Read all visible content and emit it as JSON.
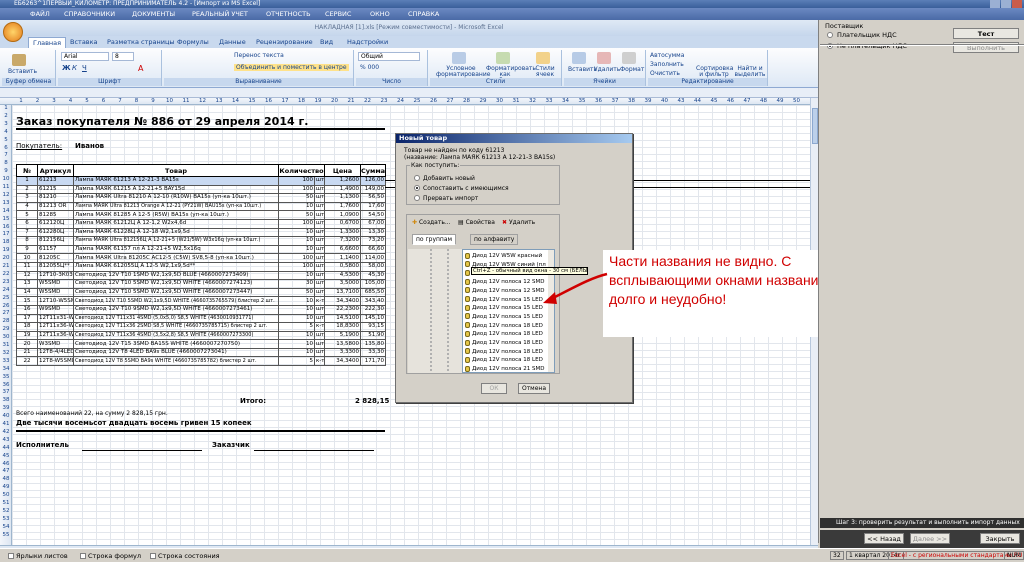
{
  "window": {
    "title": "ЕБ6263^1ПЕРВЫЙ_КИЛОМЕТР: ПРЕДПРИНИМАТЕЛЬ 4.2 - [Импорт из MS Excel]",
    "menu": [
      "ФАЙЛ",
      "СПРАВОЧНИКИ",
      "ДОКУМЕНТЫ",
      "РЕАЛЬНЫЙ УЧЕТ",
      "ОТЧЕТНОСТЬ",
      "СЕРВИС",
      "ОКНО",
      "СПРАВКА"
    ]
  },
  "excel": {
    "title": "НАКЛАДНАЯ [1].xls [Режим совместимости] - Microsoft Excel",
    "ribbon_tabs": [
      "Главная",
      "Вставка",
      "Разметка страницы",
      "Формулы",
      "Данные",
      "Рецензирование",
      "Вид",
      "Надстройки"
    ],
    "ribbon": {
      "paste": "Вставить",
      "font_name": "Arial",
      "font_size": "8",
      "wrap": "Перенос текста",
      "merge": "Объединить и поместить в центре",
      "number_format": "Общий",
      "cond_format": "Условное форматирование",
      "format_table": "Форматировать как таблицу",
      "cell_styles": "Стили ячеек",
      "insert": "Вставить",
      "delete": "Удалить",
      "format": "Формат",
      "autosum": "Автосумма",
      "fill": "Заполнить",
      "clear": "Очистить",
      "sort": "Сортировка и фильтр",
      "find": "Найти и выделить",
      "groups": [
        "Буфер обмена",
        "Шрифт",
        "Выравнивание",
        "Число",
        "Стили",
        "Ячейки",
        "Редактирование"
      ]
    },
    "columns": [
      "1",
      "2",
      "3",
      "4",
      "5",
      "6",
      "7",
      "8",
      "9",
      "10",
      "11",
      "12",
      "13",
      "14",
      "15",
      "16",
      "17",
      "18",
      "19",
      "20",
      "21",
      "22",
      "23",
      "24",
      "25",
      "26",
      "27",
      "28",
      "29",
      "30",
      "31",
      "32",
      "33",
      "34",
      "35",
      "36",
      "37",
      "38",
      "39",
      "40",
      "43",
      "44",
      "45",
      "46",
      "47",
      "48",
      "49",
      "50"
    ],
    "rows": [
      "1",
      "2",
      "3",
      "4",
      "5",
      "6",
      "7",
      "8",
      "9",
      "10",
      "11",
      "12",
      "13",
      "14",
      "15",
      "16",
      "17",
      "18",
      "19",
      "20",
      "21",
      "22",
      "23",
      "24",
      "25",
      "26",
      "27",
      "28",
      "29",
      "30",
      "31",
      "32",
      "33",
      "34",
      "35",
      "36",
      "37",
      "38",
      "39",
      "40",
      "41",
      "42",
      "43",
      "44",
      "45",
      "46",
      "47",
      "48",
      "49",
      "50",
      "51",
      "52",
      "53",
      "54",
      "55"
    ],
    "sheet_tabs": [
      "Лист1"
    ]
  },
  "document": {
    "title": "Заказ покупателя № 886 от 29 апреля 2014 г.",
    "buyer_label": "Покупатель:",
    "buyer_name": "Иванов",
    "headers": [
      "№",
      "Артикул",
      "Товар",
      "Количество",
      "Цена",
      "Сумма"
    ],
    "rows": [
      [
        "1",
        "61213",
        "Лампа МАЯК 61213 А 12-21-3 BA15s",
        "100",
        "шт",
        "1,2600",
        "126,00"
      ],
      [
        "2",
        "61215",
        "Лампа МАЯК 61215 А 12-21+5 BAY15d",
        "100",
        "шт",
        "1,4900",
        "149,00"
      ],
      [
        "3",
        "81210",
        "Лампа МАЯК Ultra 81210 А 12-10 (R10W) BA15s (уп-ка 10шт.)",
        "50",
        "шт",
        "1,1300",
        "56,50"
      ],
      [
        "4",
        "81213 OR",
        "Лампа МАЯК Ultra 81213 Orange А 12-21 (PY21W) BAU15s (уп-ка 10шт.)",
        "10",
        "шт",
        "1,7600",
        "17,60"
      ],
      [
        "5",
        "81285",
        "Лампа МАЯК 81285 А 12-5 (R5W) BA15s (уп-ка 10шт.)",
        "50",
        "шт",
        "1,0900",
        "54,50"
      ],
      [
        "6",
        "612120Ц",
        "Лампа МАЯК 61212Ц А 12-1,2 W2x4,6d",
        "100",
        "шт",
        "0,6700",
        "67,00"
      ],
      [
        "7",
        "612280Ц",
        "Лампа МАЯК 61228Ц А 12-18 W2,1x9,5d",
        "10",
        "шт",
        "1,3300",
        "13,30"
      ],
      [
        "8",
        "812156Ц",
        "Лампа МАЯК Ultra 812156Ц А 12-21+5 (W21/5W) W3x16q (уп-ка 10шт.)",
        "10",
        "шт",
        "7,3200",
        "73,20"
      ],
      [
        "9",
        "61157",
        "Лампа МАЯК 61157 пл А 12-21+5 W2,5x16q",
        "10",
        "шт",
        "6,6600",
        "66,60"
      ],
      [
        "10",
        "81205C",
        "Лампа МАЯК Ultra 81205C AC12-5 (C5W) SV8,5-8 (уп-ка 10шт.)",
        "100",
        "шт",
        "1,1400",
        "114,00"
      ],
      [
        "11",
        "812055Ц**",
        "Лампа МАЯК 612055Ц А 12-5 W2,1x9,5d**",
        "100",
        "шт",
        "0,5800",
        "58,00"
      ],
      [
        "12",
        "12T10-3К03ЭМD",
        "Светодиод 12V T10 1SMD W2,1x9,5D BLUE (4660007273409)",
        "10",
        "шт",
        "4,5300",
        "45,30"
      ],
      [
        "13",
        "W5SMD",
        "Светодиод 12V T10 5SMD W2,1x9,5D WHITE (4660007274123)",
        "30",
        "шт",
        "3,5000",
        "105,00"
      ],
      [
        "14",
        "W5SMD",
        "Светодиод 12V T10 5SMD W2,1x9,5D WHITE (4660007273447)",
        "50",
        "шт",
        "13,7100",
        "685,50"
      ],
      [
        "15",
        "12Т10-W5SMD2BL",
        "Светодиод 12V T10 5SMD W2,1x9,5D WHITE (4660735765579) блистер 2 шт.",
        "10",
        "к-т",
        "34,3400",
        "343,40"
      ],
      [
        "16",
        "W9SMD",
        "Светодиод 12V T10 9SMD W2,1x9,5D WHITE (4660007273461)",
        "10",
        "шт",
        "22,2300",
        "222,30"
      ],
      [
        "17",
        "12Т11х31-W4SMD5050",
        "Светодиод 12V T11x31 4SMD (5,0x5,0) S8,5 WHITE (4630010931771)",
        "10",
        "шт",
        "14,5100",
        "145,10"
      ],
      [
        "18",
        "12Т11х36-W2SMD2BL",
        "Светодиод 12V T11x36 2SMD S8,5 WHITE (4660735785715) блистер 2 шт.",
        "5",
        "к-т",
        "18,8300",
        "93,15"
      ],
      [
        "19",
        "12Т11х36-W4SMD",
        "Светодиод 12V T11x36 4SMD (3,5x2,8) S8,5 WHITE (4660007273300)",
        "10",
        "шт",
        "5,1900",
        "51,90"
      ],
      [
        "20",
        "W3SMD",
        "Светодиод 12V T15 3SMD BA15S WHITE (4660007270750)",
        "10",
        "шт",
        "13,5800",
        "135,80"
      ],
      [
        "21",
        "12T8-4/4LED",
        "Светодиод 12V T8 4LED BA9s BLUE (4660007273041)",
        "10",
        "шт",
        "3,3300",
        "33,30"
      ],
      [
        "22",
        "12T8-W5SMD2BL",
        "Светодиод 12V T8 5SMD BA9s WHITE (4660735785782) блистер 2 шт.",
        "5",
        "к-т",
        "34,3400",
        "171,70"
      ]
    ],
    "total_label": "Итого:",
    "total_value": "2 828,15",
    "summary_line": "Всего наименований 22, на сумму 2 828,15 грн.",
    "amount_words": "Две тысячи восемьсот двадцать восемь гривен 15 копеек",
    "executor_label": "Исполнитель",
    "customer_label": "Заказчик"
  },
  "dialog": {
    "title": "Новый товар",
    "not_found": "Товар не найден по коду 61213",
    "name_line": "(название: Лампа МАЯК 61213 А 12-21-3 BA15s)",
    "how_label": "Как поступить:",
    "options": [
      "Добавить новый",
      "Сопоставить с имеющимся",
      "Прервать импорт"
    ],
    "selected_option": 1,
    "toolbar": [
      "Создать...",
      "Свойства",
      "Удалить"
    ],
    "tabs": [
      "по группам",
      "по алфавиту"
    ],
    "items": [
      "Диод 12V W5W красный",
      "Диод 12V W5W синий (пл",
      "Диод 12V W5W оранжевый",
      "Диод 12V полоса 12 SMD",
      "Диод 12V полоса 12 SMD",
      "Диод 12V полоса 15 LED",
      "Диод 12V полоса 15 LED",
      "Диод 12V полоса 15 LED",
      "Диод 12V полоса 18 LED",
      "Диод 12V полоса 18 LED",
      "Диод 12V полоса 18 LED",
      "Диод 12V полоса 18 LED",
      "Диод 12V полоса 18 LED",
      "Диод 12V полоса 21 SMD"
    ],
    "tooltip": "Ctrl+Z - обычный вид окна - 30 см (БЕЛЫЙ)",
    "ok": "ОК",
    "cancel": "Отмена"
  },
  "annotation": {
    "text": "Части названия не видно.  С всплывающими окнами названия работать долго и неудобно!",
    "color": "#d00000"
  },
  "right_panel": {
    "supplier_label": "Поставщик",
    "vat_payer": "Плательщик НДС",
    "non_vat_payer": "Не плательщик НДС",
    "selected": 1,
    "test_button": "Тест",
    "run_button": "Выполнить",
    "step_text": "Шаг 3: проверить результат и выполнить импорт данных",
    "back_button": "<< Назад",
    "next_button": "Далее >>",
    "close_button": "Закрыть"
  },
  "status": {
    "checks": [
      "Ярлыки листов",
      "Строка формул",
      "Строка состояния"
    ],
    "count": "32",
    "period": "1 квартал 2014г",
    "link": "Excel - с региональными стандартами.RU",
    "num": "NUM"
  }
}
